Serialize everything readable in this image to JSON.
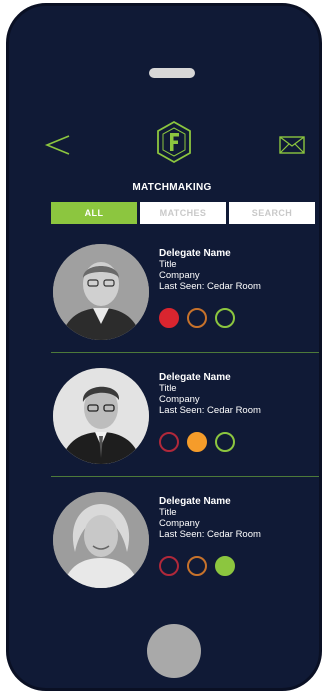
{
  "screen": {
    "title": "MATCHMAKING",
    "tabs": [
      {
        "label": "ALL",
        "active": true
      },
      {
        "label": "MATCHES",
        "active": false
      },
      {
        "label": "SEARCH",
        "active": false
      }
    ],
    "nav_icons": [
      "back-chevron-icon",
      "f-hexagon-logo-icon",
      "mail-icon"
    ]
  },
  "delegates": [
    {
      "name": "Delegate Name",
      "title": "Title",
      "company": "Company",
      "last_seen": "Last Seen: Cedar Room",
      "status": [
        {
          "color": "#d9252f",
          "filled": true
        },
        {
          "color": "#c7722b",
          "filled": false
        },
        {
          "color": "#8cc63f",
          "filled": false
        }
      ]
    },
    {
      "name": "Delegate Name",
      "title": "Title",
      "company": "Company",
      "last_seen": "Last Seen: Cedar Room",
      "status": [
        {
          "color": "#b0283a",
          "filled": false
        },
        {
          "color": "#f59c2a",
          "filled": true
        },
        {
          "color": "#8cc63f",
          "filled": false
        }
      ]
    },
    {
      "name": "Delegate Name",
      "title": "Title",
      "company": "Company",
      "last_seen": "Last Seen: Cedar Room",
      "status": [
        {
          "color": "#b0283a",
          "filled": false
        },
        {
          "color": "#c7722b",
          "filled": false
        },
        {
          "color": "#8cc63f",
          "filled": true
        }
      ]
    }
  ],
  "colors": {
    "background": "#101a36",
    "accent_green": "#8cc63f",
    "text": "#ffffff",
    "tab_inactive_text": "#c9c9c9"
  }
}
